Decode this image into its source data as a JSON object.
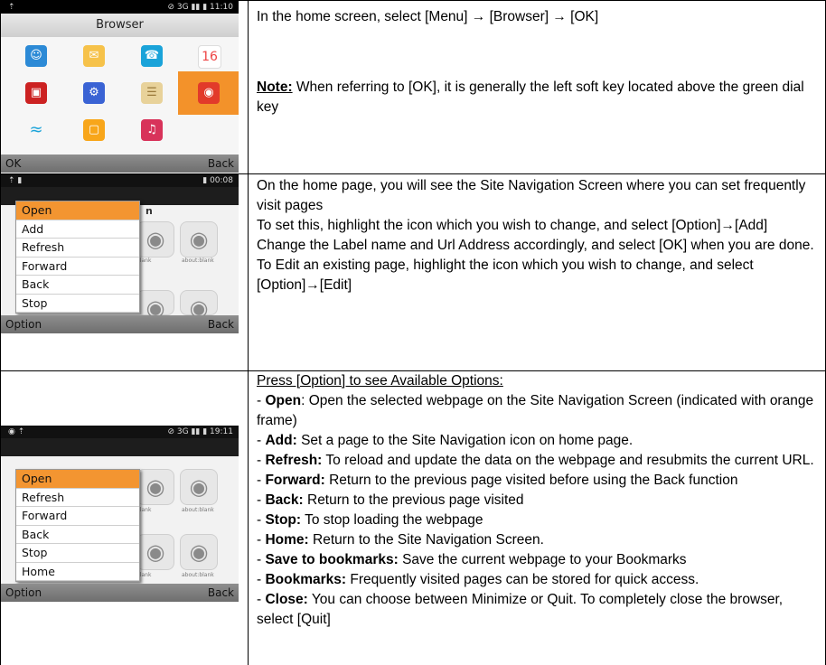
{
  "screen1": {
    "status_left": "⇡",
    "status_right": "⊘ 3G ▮▮ ▮ 11:10",
    "title": "Browser",
    "calendar_number": "16",
    "soft_left": "OK",
    "soft_right": "Back",
    "icons": [
      "contacts-icon",
      "messages-icon",
      "phone-icon",
      "calendar-icon",
      "toolbox-icon",
      "settings-icon",
      "notes-icon",
      "browser-icon",
      "wifi-icon",
      "file-manager-icon",
      "music-icon"
    ]
  },
  "screen2": {
    "status_right": "▮ 00:08",
    "menu": [
      "Open",
      "Add",
      "Refresh",
      "Forward",
      "Back",
      "Stop"
    ],
    "bg_letter": "n",
    "label_blank": "blank",
    "label_about": "about:blank",
    "soft_left": "Option",
    "soft_right": "Back"
  },
  "screen3": {
    "status_right": "⊘ 3G ▮▮ ▮ 19:11",
    "menu": [
      "Open",
      "Refresh",
      "Forward",
      "Back",
      "Stop",
      "Home"
    ],
    "label_blank": "blank",
    "label_about": "about:blank",
    "soft_left": "Option",
    "soft_right": "Back"
  },
  "row1": {
    "line1": "In the home screen, select [Menu] → [Browser] → [OK]",
    "note_label": "Note:",
    "note_text": " When referring to [OK], it is generally the left soft key located above the green dial key"
  },
  "row2": {
    "lines": [
      "On the home page, you will see the Site Navigation Screen where you can set frequently visit pages",
      "To set this, highlight the icon which you wish to change, and select [Option]→[Add]",
      "Change the Label name and Url Address accordingly, and select [OK] when you are done.",
      "To Edit an existing page, highlight the icon which you wish to change, and select [Option]→[Edit]"
    ]
  },
  "row3": {
    "heading": "Press [Option] to see Available Options:",
    "items": [
      {
        "term": "Open",
        "sep": ":",
        "desc": " Open the selected webpage on the Site Navigation Screen (indicated with orange frame)"
      },
      {
        "term": "Add:",
        "sep": "",
        "desc": " Set a page to the Site Navigation icon on home page."
      },
      {
        "term": "Refresh:",
        "sep": "",
        "desc": " To reload and update the data on the webpage and resubmits the current URL."
      },
      {
        "term": "Forward:",
        "sep": "",
        "desc": " Return to the previous page visited before using the Back function"
      },
      {
        "term": "Back:",
        "sep": "",
        "desc": " Return to the previous page visited"
      },
      {
        "term": "Stop:",
        "sep": "",
        "desc": " To stop loading the webpage"
      },
      {
        "term": "Home:",
        "sep": "",
        "desc": " Return to the Site Navigation Screen."
      },
      {
        "term": "Save to bookmarks:",
        "sep": "",
        "desc": " Save the current webpage to your Bookmarks"
      },
      {
        "term": "Bookmarks:",
        "sep": "",
        "desc": " Frequently visited pages can be stored for quick access."
      },
      {
        "term": "Close:",
        "sep": "",
        "desc": " You can choose between Minimize or Quit. To completely close the browser, select [Quit]"
      }
    ]
  }
}
